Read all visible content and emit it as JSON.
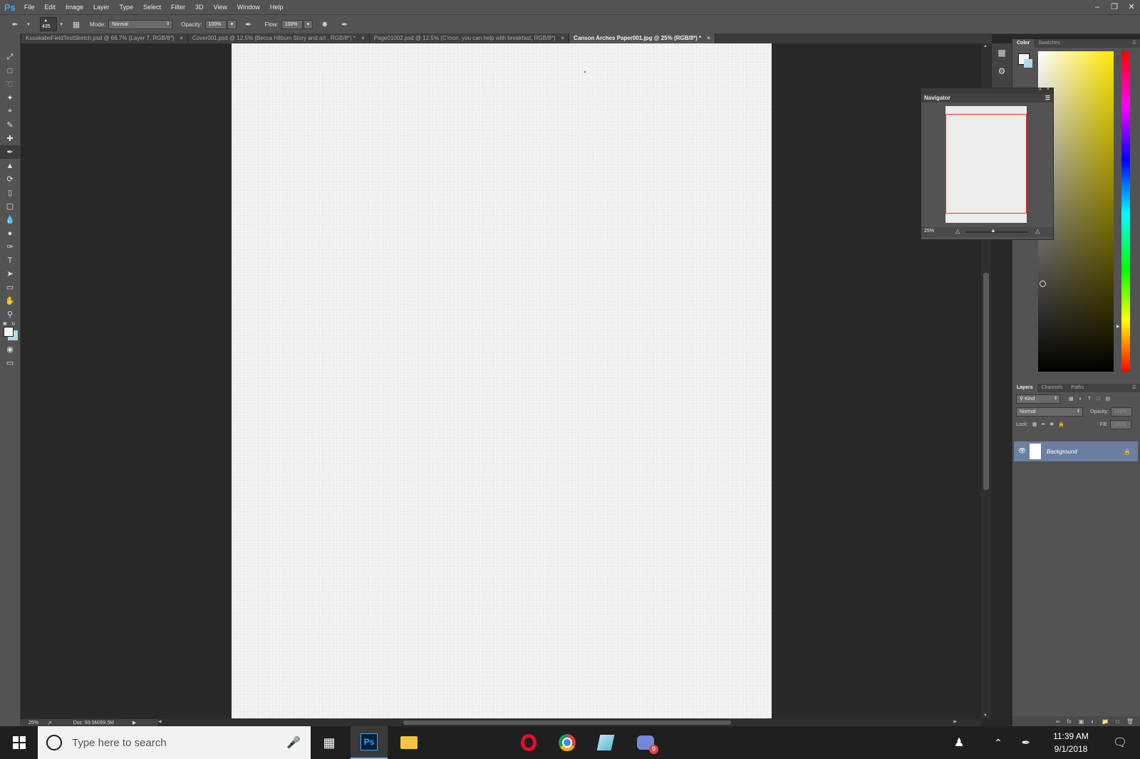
{
  "app": {
    "logo": "Ps"
  },
  "menu": [
    "File",
    "Edit",
    "Image",
    "Layer",
    "Type",
    "Select",
    "Filter",
    "3D",
    "View",
    "Window",
    "Help"
  ],
  "window_controls": [
    "minimize-icon",
    "restore-icon",
    "close-icon"
  ],
  "options": {
    "brush_size": "435",
    "mode_label": "Mode:",
    "mode_value": "Normal",
    "opacity_label": "Opacity:",
    "opacity_value": "100%",
    "flow_label": "Flow:",
    "flow_value": "100%"
  },
  "tabs": [
    {
      "label": "KusakabeFieldTestSketch.psd @ 66.7% (Layer 7, RGB/8*)",
      "active": false
    },
    {
      "label": "Cover001.psd @ 12.5% (Becca Hilbum Story and art , RGB/8*) *",
      "active": false
    },
    {
      "label": "Page01002.psd @ 12.5% (C'mon, you can help with breakfast, RGB/8*)",
      "active": false
    },
    {
      "label": "Canson Arches Paper001.jpg @ 25% (RGB/8*) *",
      "active": true
    }
  ],
  "status": {
    "zoom": "25%",
    "doc": "Doc: 69.5M/69.5M"
  },
  "navigator": {
    "title": "Navigator",
    "zoom": "25%"
  },
  "color_panel": {
    "tabs": [
      "Color",
      "Swatches"
    ]
  },
  "layers_panel": {
    "tabs": [
      "Layers",
      "Channels",
      "Paths"
    ],
    "kind_label": "Kind",
    "blend_mode": "Normal",
    "opacity_label": "Opacity:",
    "opacity_value": "100%",
    "lock_label": "Lock:",
    "fill_label": "Fill:",
    "fill_value": "100%",
    "layer_name": "Background"
  },
  "taskbar": {
    "search_placeholder": "Type here to search",
    "time": "11:39 AM",
    "date": "9/1/2018",
    "discord_badge": "9"
  }
}
